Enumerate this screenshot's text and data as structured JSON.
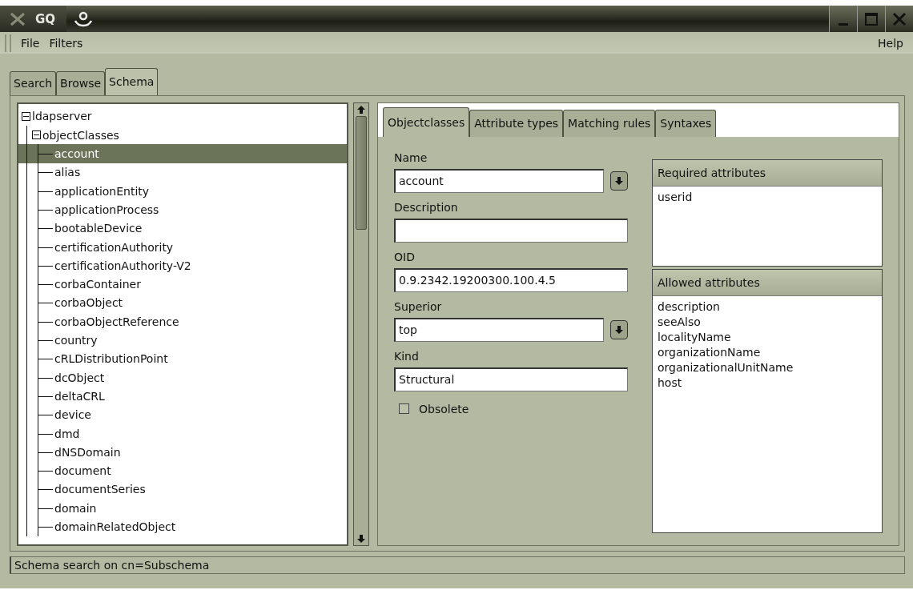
{
  "window": {
    "title": "GQ"
  },
  "menu_left": [
    {
      "label": "File"
    },
    {
      "label": "Filters"
    }
  ],
  "menu_right": [
    {
      "label": "Help"
    }
  ],
  "tabs": [
    {
      "label": "Search",
      "selected": false
    },
    {
      "label": "Browse",
      "selected": false
    },
    {
      "label": "Schema",
      "selected": true
    }
  ],
  "tree": {
    "label": "ldapserver",
    "expanded": true,
    "children": [
      {
        "label": "objectClasses",
        "expanded": true,
        "children": [
          {
            "label": "account",
            "selected": true
          },
          {
            "label": "alias",
            "selected": false
          },
          {
            "label": "applicationEntity",
            "selected": false
          },
          {
            "label": "applicationProcess",
            "selected": false
          },
          {
            "label": "bootableDevice",
            "selected": false
          },
          {
            "label": "certificationAuthority",
            "selected": false
          },
          {
            "label": "certificationAuthority-V2",
            "selected": false
          },
          {
            "label": "corbaContainer",
            "selected": false
          },
          {
            "label": "corbaObject",
            "selected": false
          },
          {
            "label": "corbaObjectReference",
            "selected": false
          },
          {
            "label": "country",
            "selected": false
          },
          {
            "label": "cRLDistributionPoint",
            "selected": false
          },
          {
            "label": "dcObject",
            "selected": false
          },
          {
            "label": "deltaCRL",
            "selected": false
          },
          {
            "label": "device",
            "selected": false
          },
          {
            "label": "dmd",
            "selected": false
          },
          {
            "label": "dNSDomain",
            "selected": false
          },
          {
            "label": "document",
            "selected": false
          },
          {
            "label": "documentSeries",
            "selected": false
          },
          {
            "label": "domain",
            "selected": false
          },
          {
            "label": "domainRelatedObject",
            "selected": false
          }
        ]
      }
    ]
  },
  "schema_tabs": [
    {
      "label": "Objectclasses",
      "selected": true
    },
    {
      "label": "Attribute types",
      "selected": false
    },
    {
      "label": "Matching rules",
      "selected": false
    },
    {
      "label": "Syntaxes",
      "selected": false
    }
  ],
  "fields": [
    {
      "kind": "combo",
      "label": "Name",
      "value": "account"
    },
    {
      "kind": "text",
      "label": "Description"
    },
    {
      "kind": "text",
      "label": "OID",
      "value": "0.9.2342.19200300.100.4.5"
    },
    {
      "kind": "combo",
      "label": "Superior",
      "value": "top"
    },
    {
      "kind": "text",
      "label": "Kind",
      "value": "Structural"
    }
  ],
  "obsolete": {
    "label": "Obsolete",
    "checked": false
  },
  "required_attributes": {
    "title": "Required attributes",
    "items": [
      "userid"
    ]
  },
  "allowed_attributes": {
    "title": "Allowed attributes",
    "items": [
      "description",
      "seeAlso",
      "localityName",
      "organizationName",
      "organizationalUnitName",
      "host"
    ]
  },
  "status_bar": "Schema search on cn=Subschema"
}
